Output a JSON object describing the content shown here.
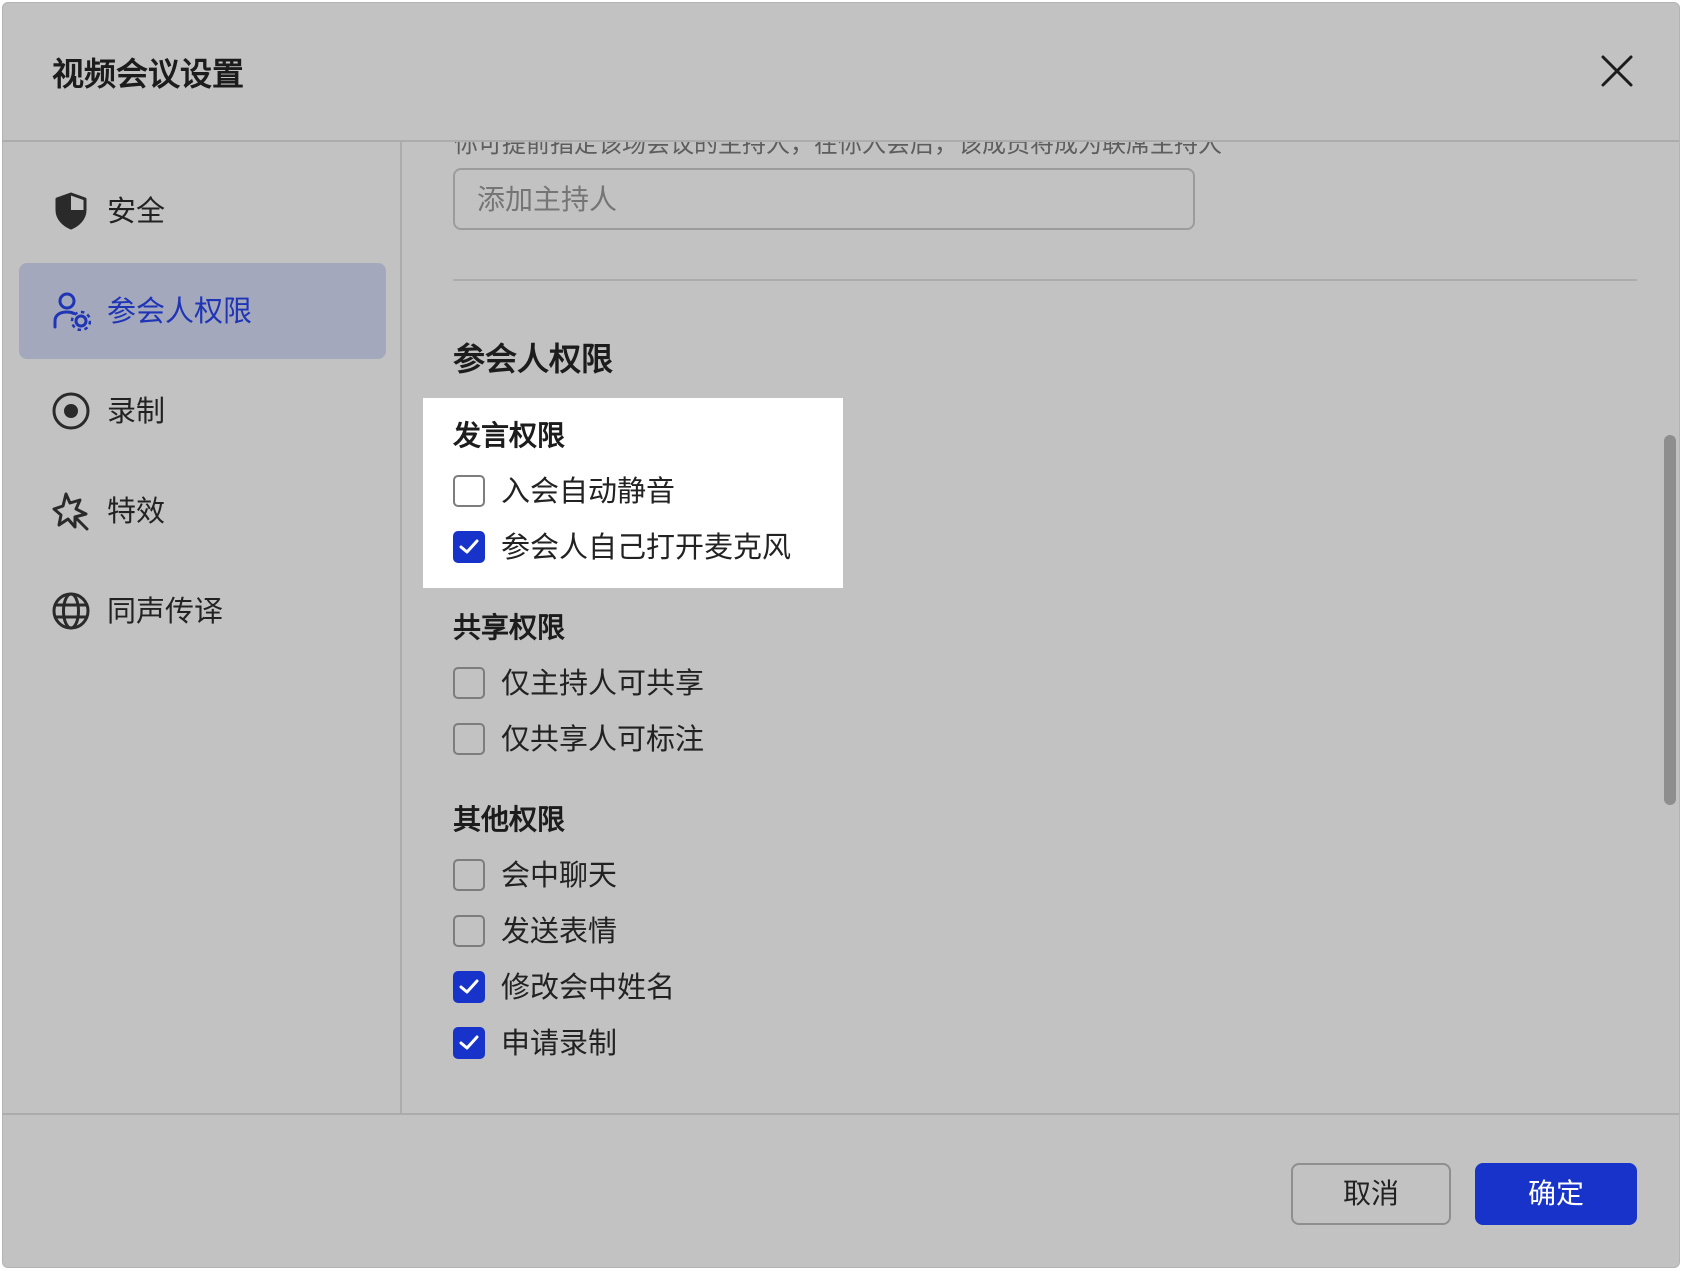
{
  "dialog": {
    "title": "视频会议设置",
    "close_icon": "close-icon"
  },
  "sidebar": {
    "items": [
      {
        "label": "安全",
        "icon": "shield-icon",
        "active": false
      },
      {
        "label": "参会人权限",
        "icon": "user-settings-icon",
        "active": true
      },
      {
        "label": "录制",
        "icon": "record-icon",
        "active": false
      },
      {
        "label": "特效",
        "icon": "sparkle-icon",
        "active": false
      },
      {
        "label": "同声传译",
        "icon": "globe-icon",
        "active": false
      }
    ]
  },
  "host": {
    "hint": "你可提前指定该场会议的主持人，在你入会后，该成员将成为联席主持人",
    "placeholder": "添加主持人"
  },
  "permissions": {
    "title": "参会人权限",
    "speak": {
      "title": "发言权限",
      "options": [
        {
          "label": "入会自动静音",
          "checked": false
        },
        {
          "label": "参会人自己打开麦克风",
          "checked": true
        }
      ]
    },
    "share": {
      "title": "共享权限",
      "options": [
        {
          "label": "仅主持人可共享",
          "checked": false
        },
        {
          "label": "仅共享人可标注",
          "checked": false
        }
      ]
    },
    "other": {
      "title": "其他权限",
      "options": [
        {
          "label": "会中聊天",
          "checked": false
        },
        {
          "label": "发送表情",
          "checked": false
        },
        {
          "label": "修改会中姓名",
          "checked": true
        },
        {
          "label": "申请录制",
          "checked": true
        }
      ]
    }
  },
  "footer": {
    "cancel_label": "取消",
    "ok_label": "确定"
  },
  "colors": {
    "accent": "#1733c9",
    "active_nav_bg": "#a3a8bd",
    "overlay_bg": "#c2c2c2"
  }
}
